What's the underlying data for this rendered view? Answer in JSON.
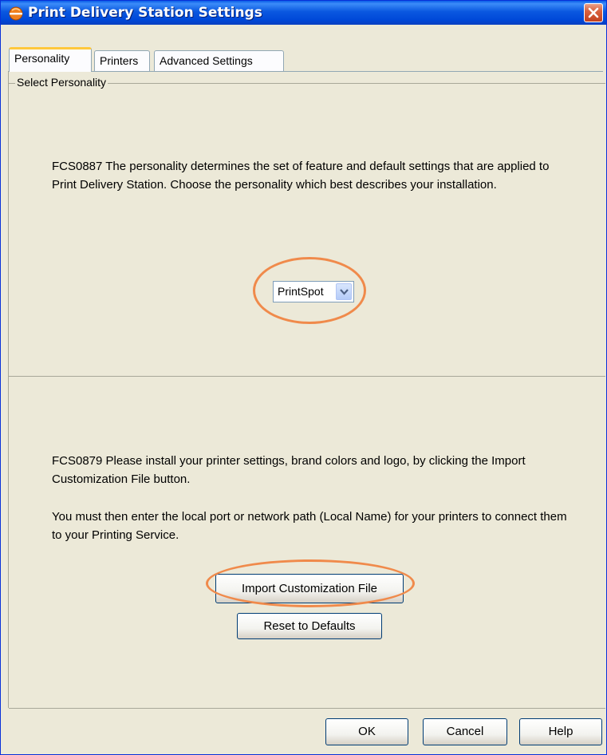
{
  "window": {
    "title": "Print Delivery Station Settings",
    "app_icon": "orange-disc-icon",
    "close_icon": "close-x-icon"
  },
  "tabs": [
    {
      "label": "Personality",
      "active": true
    },
    {
      "label": "Printers",
      "active": false
    },
    {
      "label": "Advanced Settings",
      "active": false
    }
  ],
  "group": {
    "label": "Select Personality"
  },
  "personality_text": "FCS0887 The personality determines the set of feature and default settings that are applied to Print Delivery Station.  Choose the personality which best describes your installation.",
  "personality_select": {
    "value": "PrintSpot"
  },
  "customization": {
    "text1": "FCS0879 Please install your printer settings, brand colors and logo, by clicking the Import Customization File button.",
    "text2": "You must then enter the local port or network path (Local Name) for your printers to connect them to your Printing Service.",
    "import_label": "Import Customization File",
    "reset_label": "Reset to Defaults"
  },
  "footer": {
    "ok_label": "OK",
    "cancel_label": "Cancel",
    "help_label": "Help"
  },
  "colors": {
    "titlebar": "#0a58e0",
    "annotation": "#f08a4b",
    "background": "#ece9d8"
  }
}
